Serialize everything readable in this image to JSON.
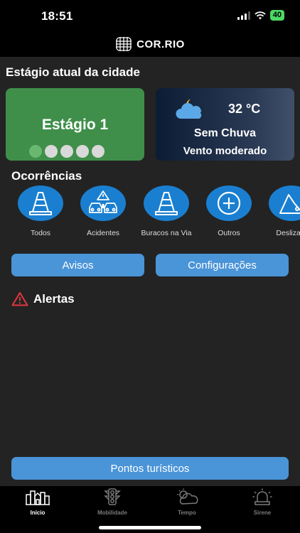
{
  "status": {
    "time": "18:51",
    "battery": "40"
  },
  "header": {
    "logo_text": "COR.RIO"
  },
  "city_stage": {
    "title": "Estágio atual da cidade",
    "stage_label": "Estágio 1",
    "stage_level": 1,
    "stage_max": 5
  },
  "weather": {
    "temperature": "32 °C",
    "condition": "Sem Chuva",
    "wind": "Vento moderado",
    "icon": "moon-cloud-icon"
  },
  "occurrences": {
    "title": "Ocorrências",
    "items": [
      {
        "label": "Todos",
        "icon": "traffic-cone-icon"
      },
      {
        "label": "Acidentes",
        "icon": "car-accident-icon"
      },
      {
        "label": "Buracos na Via",
        "icon": "traffic-cone-icon"
      },
      {
        "label": "Outros",
        "icon": "plus-icon"
      },
      {
        "label": "Deslizam",
        "icon": "landslide-icon"
      }
    ]
  },
  "actions": {
    "avisos": "Avisos",
    "configuracoes": "Configurações"
  },
  "alerts": {
    "title": "Alertas"
  },
  "tourism_button": "Pontos turísticos",
  "tabs": [
    {
      "label": "Início",
      "icon": "city-home-icon",
      "active": true
    },
    {
      "label": "Mobilidade",
      "icon": "traffic-light-icon",
      "active": false
    },
    {
      "label": "Tempo",
      "icon": "sun-cloud-icon",
      "active": false
    },
    {
      "label": "Sirene",
      "icon": "siren-icon",
      "active": false
    }
  ],
  "colors": {
    "stage_green": "#3f8f4a",
    "accent_blue": "#1a7fd0",
    "button_blue": "#4a94d8",
    "alert_red": "#e0373f"
  }
}
